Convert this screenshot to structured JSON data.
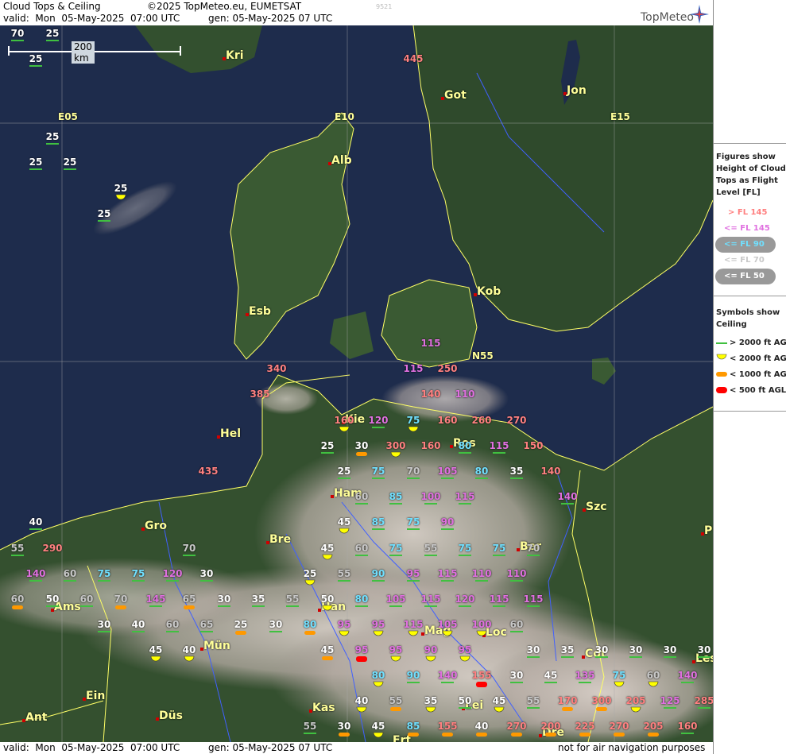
{
  "header": {
    "title": "Cloud Tops & Ceiling",
    "copyright": "©2025 TopMeteo.eu, EUMETSAT",
    "valid": "valid:  Mon  05-May-2025  07:00 UTC",
    "gen": "gen: 05-May-2025 07 UTC",
    "id": "9521",
    "logo": "TopMeteo"
  },
  "footer": {
    "valid": "valid:  Mon  05-May-2025  07:00 UTC",
    "gen": "gen: 05-May-2025 07 UTC",
    "disclaimer": "not for air navigation purposes"
  },
  "scale": {
    "label": "200 km"
  },
  "colors": {
    "fl_gt145": "#ff8080",
    "fl_le145": "#e070e0",
    "fl_le90": "#70e0ff",
    "fl_le70": "#c8c8c8",
    "fl_le50": "#ffffff",
    "ceil_gt2000": "#40c040",
    "ceil_lt2000": "#ffff00",
    "ceil_lt1000": "#ff9900",
    "ceil_lt500": "#ff0000"
  },
  "legend": {
    "tops_title": [
      "Figures show",
      "Height of Cloud",
      "Tops as Flight",
      "Level  [FL]"
    ],
    "tops": [
      {
        "label": "> FL 145",
        "color": "#ff8080"
      },
      {
        "label": "<= FL 145",
        "color": "#e070e0"
      },
      {
        "label": "<= FL 90",
        "color": "#70e0ff"
      },
      {
        "label": "<= FL 70",
        "color": "#c8c8c8"
      },
      {
        "label": "<= FL 50",
        "color": "#ffffff"
      }
    ],
    "ceil_title": [
      "Symbols show",
      "Ceiling"
    ],
    "ceil": [
      {
        "label": "> 2000 ft AGL",
        "icon": "line-icon"
      },
      {
        "label": "< 2000 ft AGL",
        "icon": "yellow-half-circle-icon"
      },
      {
        "label": "< 1000 ft AGL",
        "icon": "orange-pill-icon"
      },
      {
        "label": "< 500 ft AGL",
        "icon": "red-pill-icon"
      }
    ]
  },
  "grid_labels": [
    {
      "text": "E05"
    },
    {
      "text": "E10"
    },
    {
      "text": "E15"
    },
    {
      "text": "N55"
    }
  ],
  "cities": [
    {
      "name": "Kri"
    },
    {
      "name": "Got"
    },
    {
      "name": "Jon"
    },
    {
      "name": "Alb"
    },
    {
      "name": "Esb"
    },
    {
      "name": "Kob"
    },
    {
      "name": "Hel"
    },
    {
      "name": "Kie"
    },
    {
      "name": "Ros"
    },
    {
      "name": "Ham"
    },
    {
      "name": "Szc"
    },
    {
      "name": "Gro"
    },
    {
      "name": "Bre"
    },
    {
      "name": "Ams"
    },
    {
      "name": "Han"
    },
    {
      "name": "Ber"
    },
    {
      "name": "Mag"
    },
    {
      "name": "Loc"
    },
    {
      "name": "Mün"
    },
    {
      "name": "Cot"
    },
    {
      "name": "Ein"
    },
    {
      "name": "Kas"
    },
    {
      "name": "Lei"
    },
    {
      "name": "Ant"
    },
    {
      "name": "Düs"
    },
    {
      "name": "Erf"
    },
    {
      "name": "Dre"
    },
    {
      "name": "Les"
    },
    {
      "name": "P"
    }
  ],
  "obs": [
    {
      "v": "70",
      "c": "w"
    },
    {
      "v": "25",
      "c": "w"
    },
    {
      "v": "25",
      "c": "w"
    },
    {
      "v": "445",
      "c": "r"
    },
    {
      "v": "25",
      "c": "w"
    },
    {
      "v": "25",
      "c": "w"
    },
    {
      "v": "25",
      "c": "w"
    },
    {
      "v": "25",
      "c": "w"
    },
    {
      "v": "25",
      "c": "w"
    },
    {
      "v": "115",
      "c": "p"
    },
    {
      "v": "115",
      "c": "p"
    },
    {
      "v": "250",
      "c": "r"
    },
    {
      "v": "340",
      "c": "r"
    },
    {
      "v": "385",
      "c": "r"
    },
    {
      "v": "140",
      "c": "r"
    },
    {
      "v": "110",
      "c": "p"
    },
    {
      "v": "160",
      "c": "r"
    },
    {
      "v": "120",
      "c": "p"
    },
    {
      "v": "75",
      "c": "b"
    },
    {
      "v": "160",
      "c": "r"
    },
    {
      "v": "260",
      "c": "r"
    },
    {
      "v": "270",
      "c": "r"
    },
    {
      "v": "25",
      "c": "w"
    },
    {
      "v": "30",
      "c": "w"
    },
    {
      "v": "300",
      "c": "r"
    },
    {
      "v": "160",
      "c": "r"
    },
    {
      "v": "80",
      "c": "b"
    },
    {
      "v": "115",
      "c": "p"
    },
    {
      "v": "150",
      "c": "r"
    },
    {
      "v": "435",
      "c": "r"
    },
    {
      "v": "25",
      "c": "w"
    },
    {
      "v": "75",
      "c": "b"
    },
    {
      "v": "70",
      "c": "g"
    },
    {
      "v": "105",
      "c": "p"
    },
    {
      "v": "80",
      "c": "b"
    },
    {
      "v": "35",
      "c": "w"
    },
    {
      "v": "140",
      "c": "r"
    },
    {
      "v": "60",
      "c": "g"
    },
    {
      "v": "85",
      "c": "b"
    },
    {
      "v": "100",
      "c": "p"
    },
    {
      "v": "115",
      "c": "p"
    },
    {
      "v": "140",
      "c": "p"
    },
    {
      "v": "40",
      "c": "w"
    },
    {
      "v": "45",
      "c": "w"
    },
    {
      "v": "85",
      "c": "b"
    },
    {
      "v": "75",
      "c": "b"
    },
    {
      "v": "90",
      "c": "p"
    },
    {
      "v": "55",
      "c": "g"
    },
    {
      "v": "290",
      "c": "r"
    },
    {
      "v": "70",
      "c": "g"
    },
    {
      "v": "45",
      "c": "w"
    },
    {
      "v": "60",
      "c": "g"
    },
    {
      "v": "75",
      "c": "b"
    },
    {
      "v": "55",
      "c": "g"
    },
    {
      "v": "75",
      "c": "b"
    },
    {
      "v": "75",
      "c": "b"
    },
    {
      "v": "70",
      "c": "g"
    },
    {
      "v": "140",
      "c": "p"
    },
    {
      "v": "60",
      "c": "g"
    },
    {
      "v": "75",
      "c": "b"
    },
    {
      "v": "75",
      "c": "b"
    },
    {
      "v": "120",
      "c": "p"
    },
    {
      "v": "30",
      "c": "w"
    },
    {
      "v": "25",
      "c": "w"
    },
    {
      "v": "55",
      "c": "g"
    },
    {
      "v": "90",
      "c": "b"
    },
    {
      "v": "95",
      "c": "p"
    },
    {
      "v": "115",
      "c": "p"
    },
    {
      "v": "110",
      "c": "p"
    },
    {
      "v": "110",
      "c": "p"
    },
    {
      "v": "60",
      "c": "g"
    },
    {
      "v": "50",
      "c": "w"
    },
    {
      "v": "60",
      "c": "g"
    },
    {
      "v": "70",
      "c": "g"
    },
    {
      "v": "145",
      "c": "p"
    },
    {
      "v": "65",
      "c": "g"
    },
    {
      "v": "30",
      "c": "w"
    },
    {
      "v": "35",
      "c": "w"
    },
    {
      "v": "55",
      "c": "g"
    },
    {
      "v": "50",
      "c": "w"
    },
    {
      "v": "80",
      "c": "b"
    },
    {
      "v": "105",
      "c": "p"
    },
    {
      "v": "115",
      "c": "p"
    },
    {
      "v": "120",
      "c": "p"
    },
    {
      "v": "115",
      "c": "p"
    },
    {
      "v": "115",
      "c": "p"
    },
    {
      "v": "30",
      "c": "w"
    },
    {
      "v": "40",
      "c": "w"
    },
    {
      "v": "60",
      "c": "g"
    },
    {
      "v": "65",
      "c": "g"
    },
    {
      "v": "25",
      "c": "w"
    },
    {
      "v": "30",
      "c": "w"
    },
    {
      "v": "80",
      "c": "b"
    },
    {
      "v": "95",
      "c": "p"
    },
    {
      "v": "95",
      "c": "p"
    },
    {
      "v": "115",
      "c": "p"
    },
    {
      "v": "105",
      "c": "p"
    },
    {
      "v": "100",
      "c": "p"
    },
    {
      "v": "60",
      "c": "g"
    },
    {
      "v": "45",
      "c": "w"
    },
    {
      "v": "40",
      "c": "w"
    },
    {
      "v": "45",
      "c": "w"
    },
    {
      "v": "95",
      "c": "p"
    },
    {
      "v": "95",
      "c": "p"
    },
    {
      "v": "90",
      "c": "p"
    },
    {
      "v": "95",
      "c": "p"
    },
    {
      "v": "30",
      "c": "w"
    },
    {
      "v": "35",
      "c": "w"
    },
    {
      "v": "30",
      "c": "w"
    },
    {
      "v": "30",
      "c": "w"
    },
    {
      "v": "30",
      "c": "w"
    },
    {
      "v": "30",
      "c": "w"
    },
    {
      "v": "80",
      "c": "b"
    },
    {
      "v": "90",
      "c": "b"
    },
    {
      "v": "140",
      "c": "p"
    },
    {
      "v": "155",
      "c": "r"
    },
    {
      "v": "30",
      "c": "w"
    },
    {
      "v": "45",
      "c": "w"
    },
    {
      "v": "135",
      "c": "p"
    },
    {
      "v": "75",
      "c": "b"
    },
    {
      "v": "60",
      "c": "g"
    },
    {
      "v": "140",
      "c": "p"
    },
    {
      "v": "40",
      "c": "w"
    },
    {
      "v": "55",
      "c": "g"
    },
    {
      "v": "35",
      "c": "w"
    },
    {
      "v": "50",
      "c": "w"
    },
    {
      "v": "45",
      "c": "w"
    },
    {
      "v": "55",
      "c": "g"
    },
    {
      "v": "170",
      "c": "r"
    },
    {
      "v": "300",
      "c": "r"
    },
    {
      "v": "205",
      "c": "r"
    },
    {
      "v": "125",
      "c": "p"
    },
    {
      "v": "285",
      "c": "r"
    },
    {
      "v": "55",
      "c": "g"
    },
    {
      "v": "30",
      "c": "w"
    },
    {
      "v": "45",
      "c": "w"
    },
    {
      "v": "85",
      "c": "b"
    },
    {
      "v": "155",
      "c": "r"
    },
    {
      "v": "40",
      "c": "w"
    },
    {
      "v": "270",
      "c": "r"
    },
    {
      "v": "200",
      "c": "r"
    },
    {
      "v": "225",
      "c": "r"
    },
    {
      "v": "270",
      "c": "r"
    },
    {
      "v": "205",
      "c": "r"
    },
    {
      "v": "160",
      "c": "r"
    }
  ]
}
